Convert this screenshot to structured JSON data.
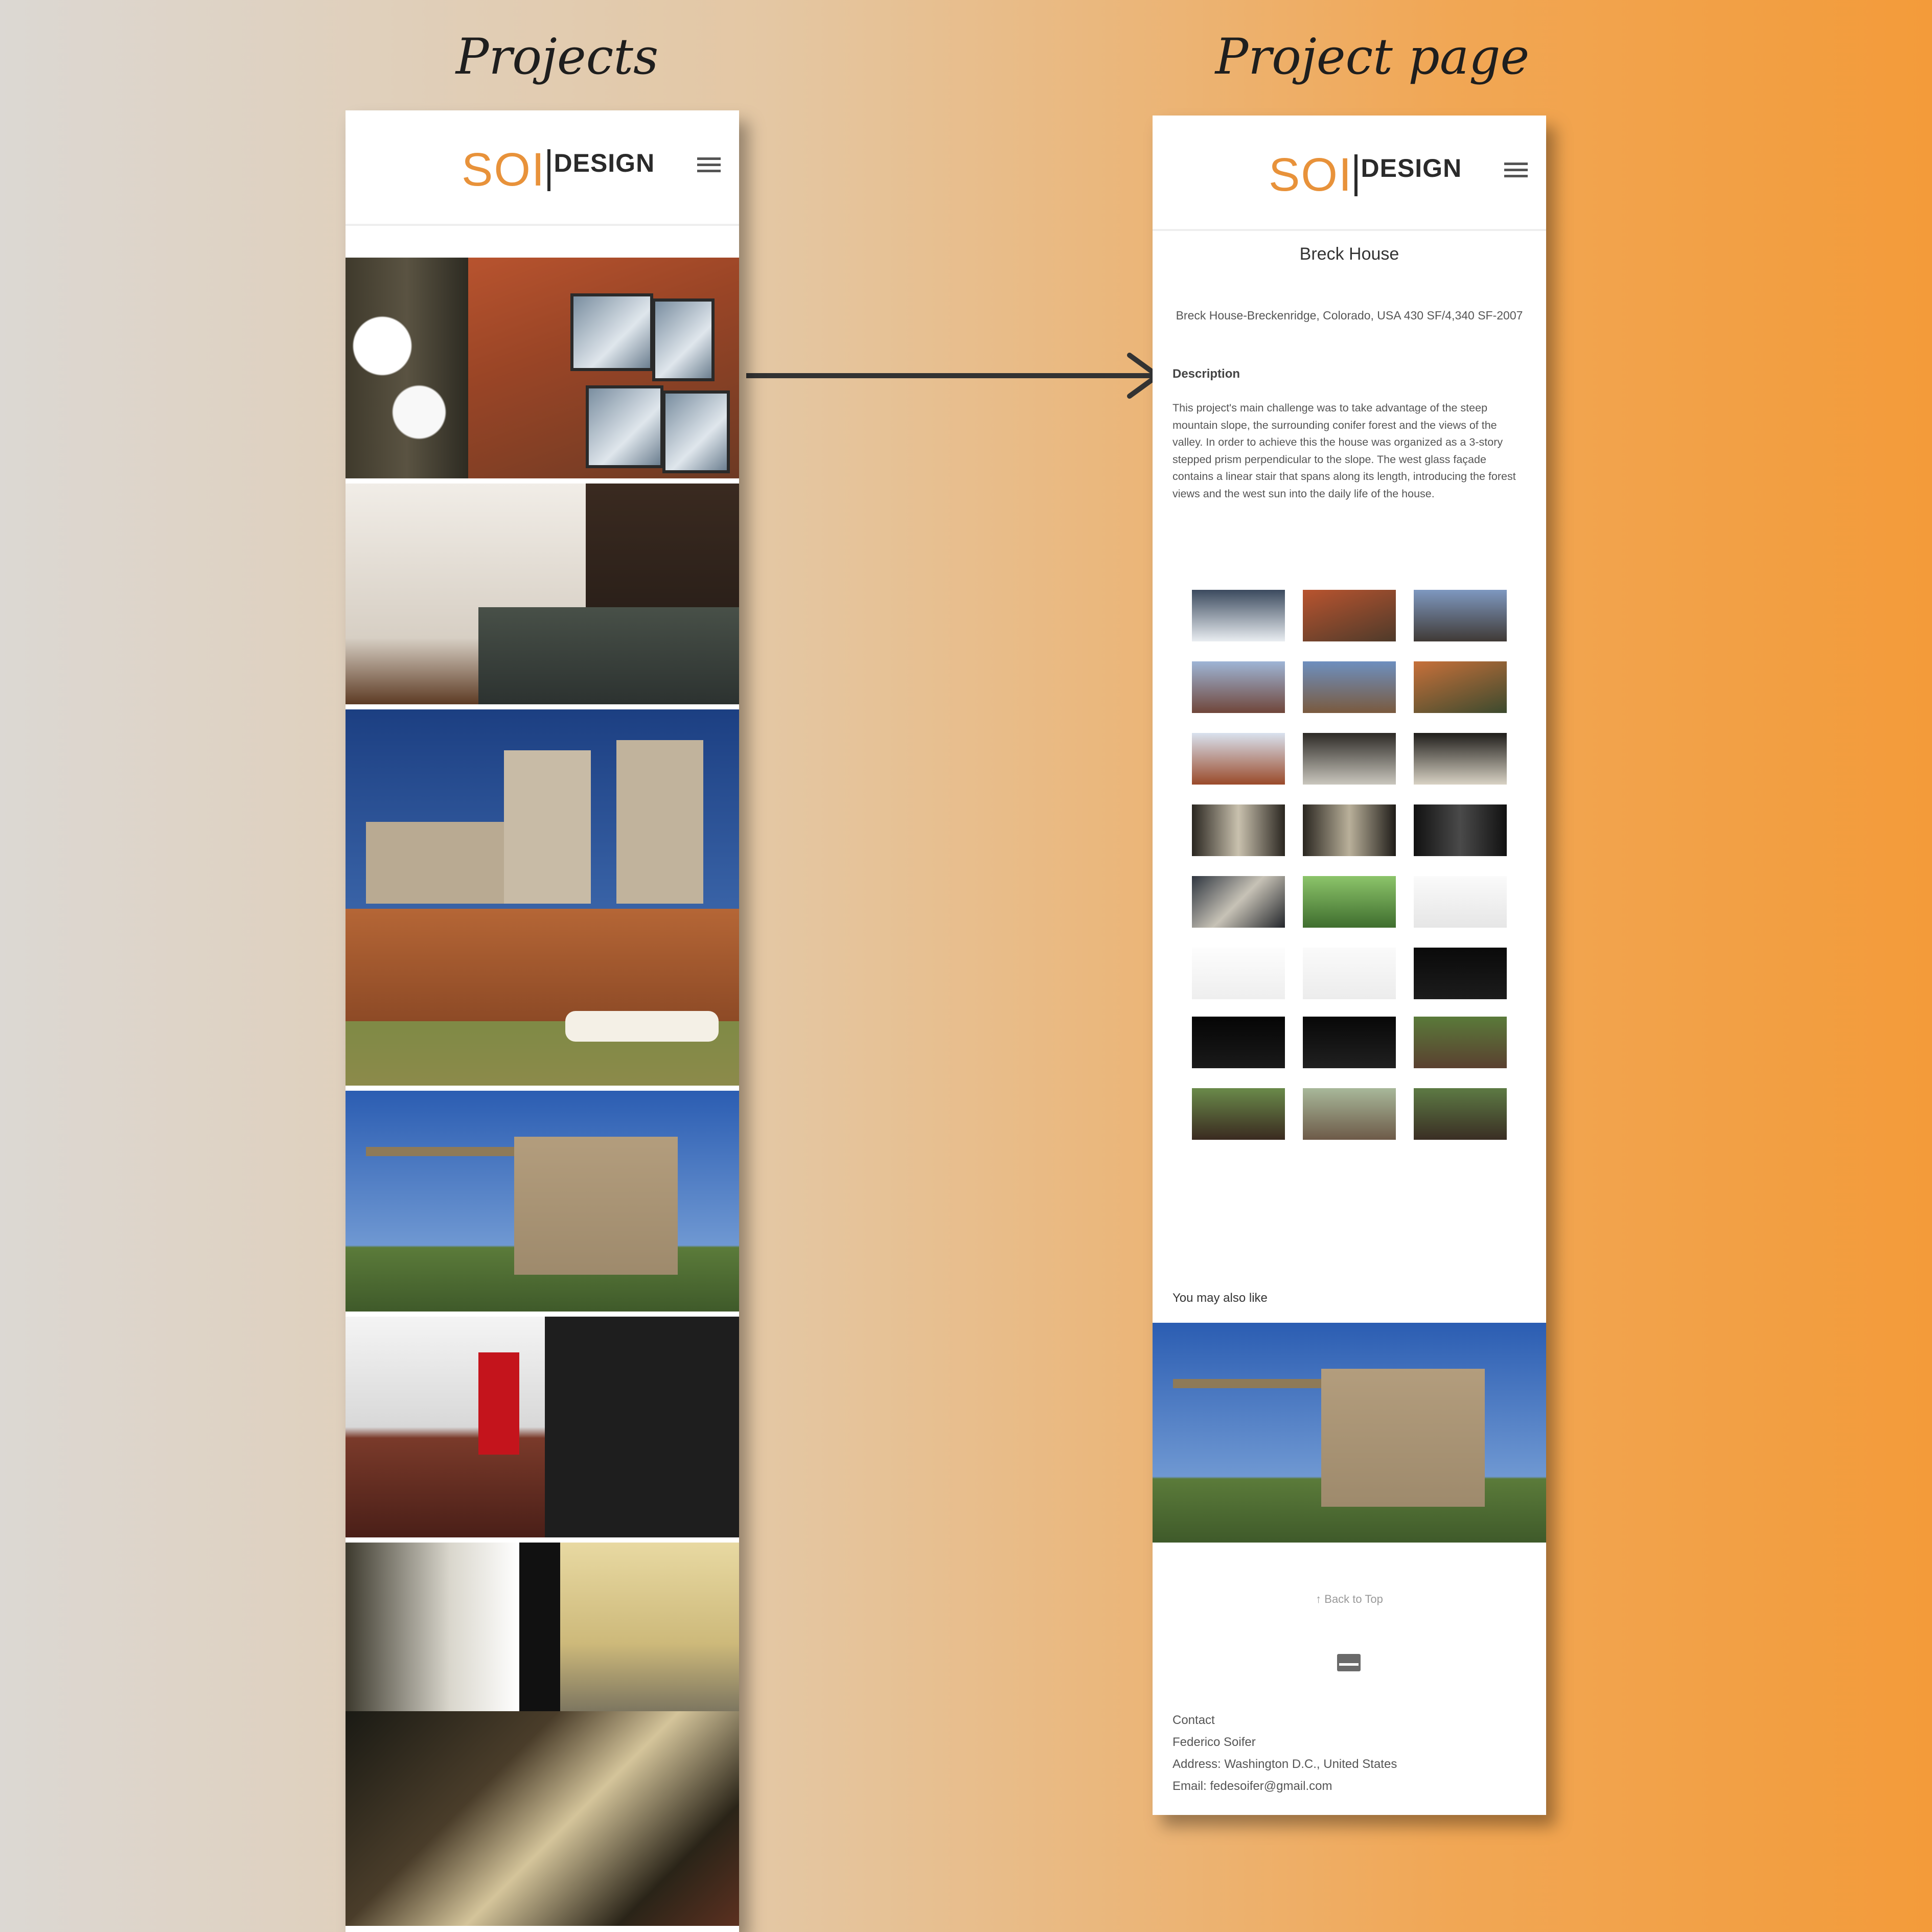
{
  "captions": {
    "left": "Projects",
    "right": "Project page"
  },
  "brand": {
    "soi": "SOI",
    "design": "DESIGN",
    "accent": "#e8923a"
  },
  "project": {
    "title": "Breck House",
    "meta": "Breck House-Breckenridge, Colorado, USA 430 SF/4,340 SF-2007",
    "description_heading": "Description",
    "description": "This project's main challenge was to take advantage of the steep mountain slope, the surrounding conifer forest and the views of the valley. In order to achieve this the house was organized as a 3-story stepped prism perpendicular to the slope. The west glass façade contains a linear stair that spans along its length, introducing the forest views and the west sun into the daily life of the house.",
    "gallery_count": 24
  },
  "related": {
    "heading": "You may also like"
  },
  "footer": {
    "back_to_top": "↑ Back to Top",
    "contact_heading": "Contact",
    "name": "Federico Soifer",
    "address": "Address: Washington D.C., United States",
    "email": "Email: fedesoifer@gmail.com"
  },
  "icons": {
    "menu": "hamburger-icon",
    "mail": "envelope-icon",
    "arrow": "arrow-right-icon"
  }
}
